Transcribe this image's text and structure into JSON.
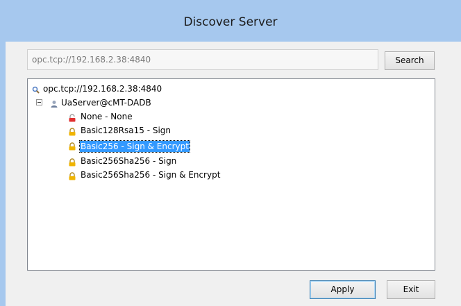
{
  "window": {
    "title": "Discover Server"
  },
  "search": {
    "url_value": "opc.tcp://192.168.2.38:4840",
    "search_label": "Search"
  },
  "tree": {
    "root_label": "opc.tcp://192.168.2.38:4840",
    "server_label": "UaServer@cMT-DADB",
    "endpoints": [
      {
        "label": "None - None",
        "icon": "unlocked-icon",
        "selected": false
      },
      {
        "label": "Basic128Rsa15 - Sign",
        "icon": "lock-icon",
        "selected": false
      },
      {
        "label": "Basic256 - Sign & Encrypt",
        "icon": "lock-icon",
        "selected": true
      },
      {
        "label": "Basic256Sha256 - Sign",
        "icon": "lock-icon",
        "selected": false
      },
      {
        "label": "Basic256Sha256 - Sign & Encrypt",
        "icon": "lock-icon",
        "selected": false
      }
    ]
  },
  "footer": {
    "apply_label": "Apply",
    "exit_label": "Exit"
  },
  "colors": {
    "title_bar": "#a6c8ee",
    "selection": "#3399ff",
    "lock": "#f0b400",
    "unlocked": "#e03030"
  }
}
